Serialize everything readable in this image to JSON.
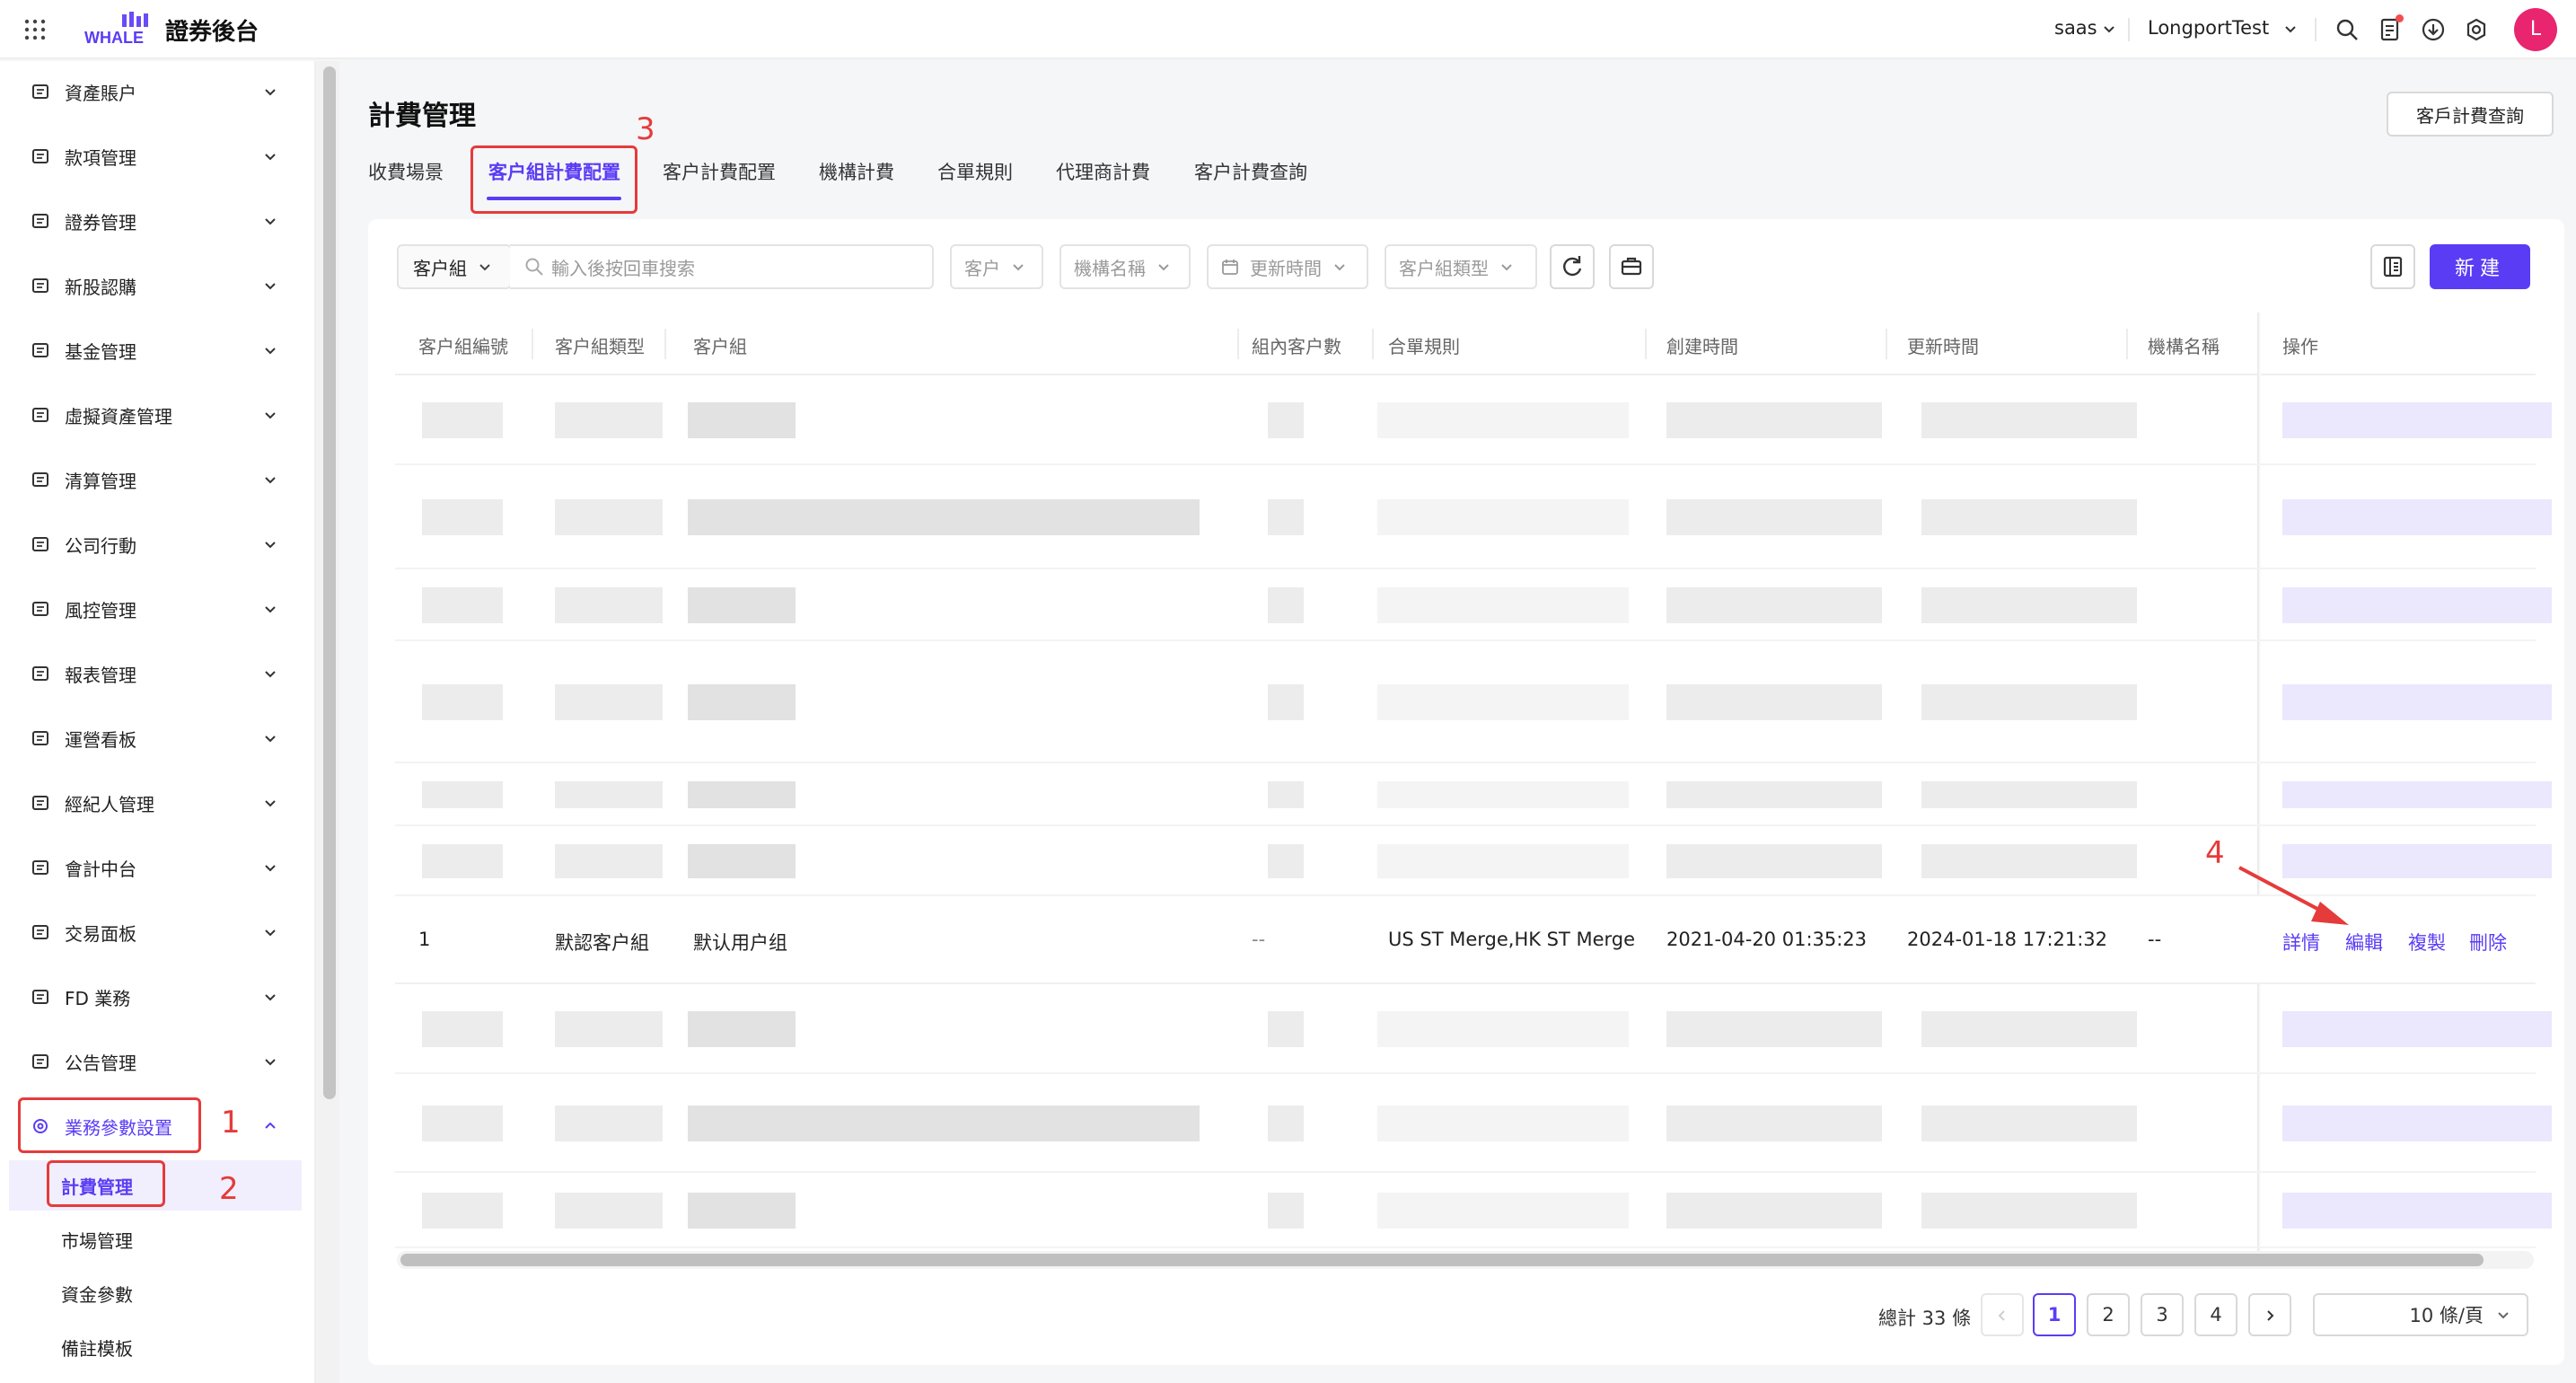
{
  "header": {
    "brand_title": "證券後台",
    "env_label": "saas",
    "org_label": "LongportTest",
    "avatar_letter": "L"
  },
  "sidebar": {
    "items": [
      {
        "label": "資產賬户",
        "icon": "wallet-icon"
      },
      {
        "label": "款項管理",
        "icon": "ledger-icon"
      },
      {
        "label": "證券管理",
        "icon": "chart-box-icon"
      },
      {
        "label": "新股認購",
        "icon": "ipo-icon"
      },
      {
        "label": "基金管理",
        "icon": "fund-icon"
      },
      {
        "label": "虛擬資產管理",
        "icon": "virtual-asset-icon"
      },
      {
        "label": "清算管理",
        "icon": "clearing-icon"
      },
      {
        "label": "公司行動",
        "icon": "corporate-action-icon"
      },
      {
        "label": "風控管理",
        "icon": "risk-icon"
      },
      {
        "label": "報表管理",
        "icon": "report-icon"
      },
      {
        "label": "運營看板",
        "icon": "line-chart-icon"
      },
      {
        "label": "經紀人管理",
        "icon": "user-icon"
      },
      {
        "label": "會計中台",
        "icon": "accounting-icon"
      },
      {
        "label": "交易面板",
        "icon": "grid-icon"
      },
      {
        "label": "FD 業務",
        "icon": "bank-icon"
      },
      {
        "label": "公告管理",
        "icon": "announcement-icon"
      },
      {
        "label": "業務參數設置",
        "icon": "gear-icon"
      }
    ],
    "sub_items": [
      {
        "label": "計費管理"
      },
      {
        "label": "市場管理"
      },
      {
        "label": "資金參數"
      },
      {
        "label": "備註模板"
      }
    ]
  },
  "annotations": [
    "1",
    "2",
    "3",
    "4"
  ],
  "page": {
    "title": "計費管理",
    "query_button": "客戶計費查詢"
  },
  "tabs": [
    {
      "label": "收費場景"
    },
    {
      "label": "客户組計費配置"
    },
    {
      "label": "客户計費配置"
    },
    {
      "label": "機構計費"
    },
    {
      "label": "合單規則"
    },
    {
      "label": "代理商計費"
    },
    {
      "label": "客户計費查詢"
    }
  ],
  "filters": {
    "group_select": "客户組",
    "search_placeholder": "輸入後按回車搜索",
    "customer": "客户",
    "institution": "機構名稱",
    "update_time": "更新時間",
    "group_type": "客户組類型",
    "new_button": "新建"
  },
  "table": {
    "columns": [
      "客户組編號",
      "客户組類型",
      "客户組",
      "組內客户數",
      "合單規則",
      "創建時間",
      "更新時間",
      "機構名稱",
      "操作"
    ],
    "visible_row": {
      "id": "1",
      "type": "默認客户組",
      "group": "默认用户组",
      "count": "--",
      "rule": "US ST Merge,HK ST Merge",
      "created": "2021-04-20 01:35:23",
      "updated": "2024-01-18 17:21:32",
      "institution": "--",
      "actions": [
        "詳情",
        "編輯",
        "複製",
        "刪除"
      ]
    }
  },
  "pagination": {
    "total": "總計 33 條",
    "pages": [
      "1",
      "2",
      "3",
      "4"
    ],
    "current": "1",
    "page_size": "10 條/頁"
  },
  "colors": {
    "accent": "#5b3cf5",
    "annotation": "#e53b3b",
    "avatar": "#e8256e"
  }
}
